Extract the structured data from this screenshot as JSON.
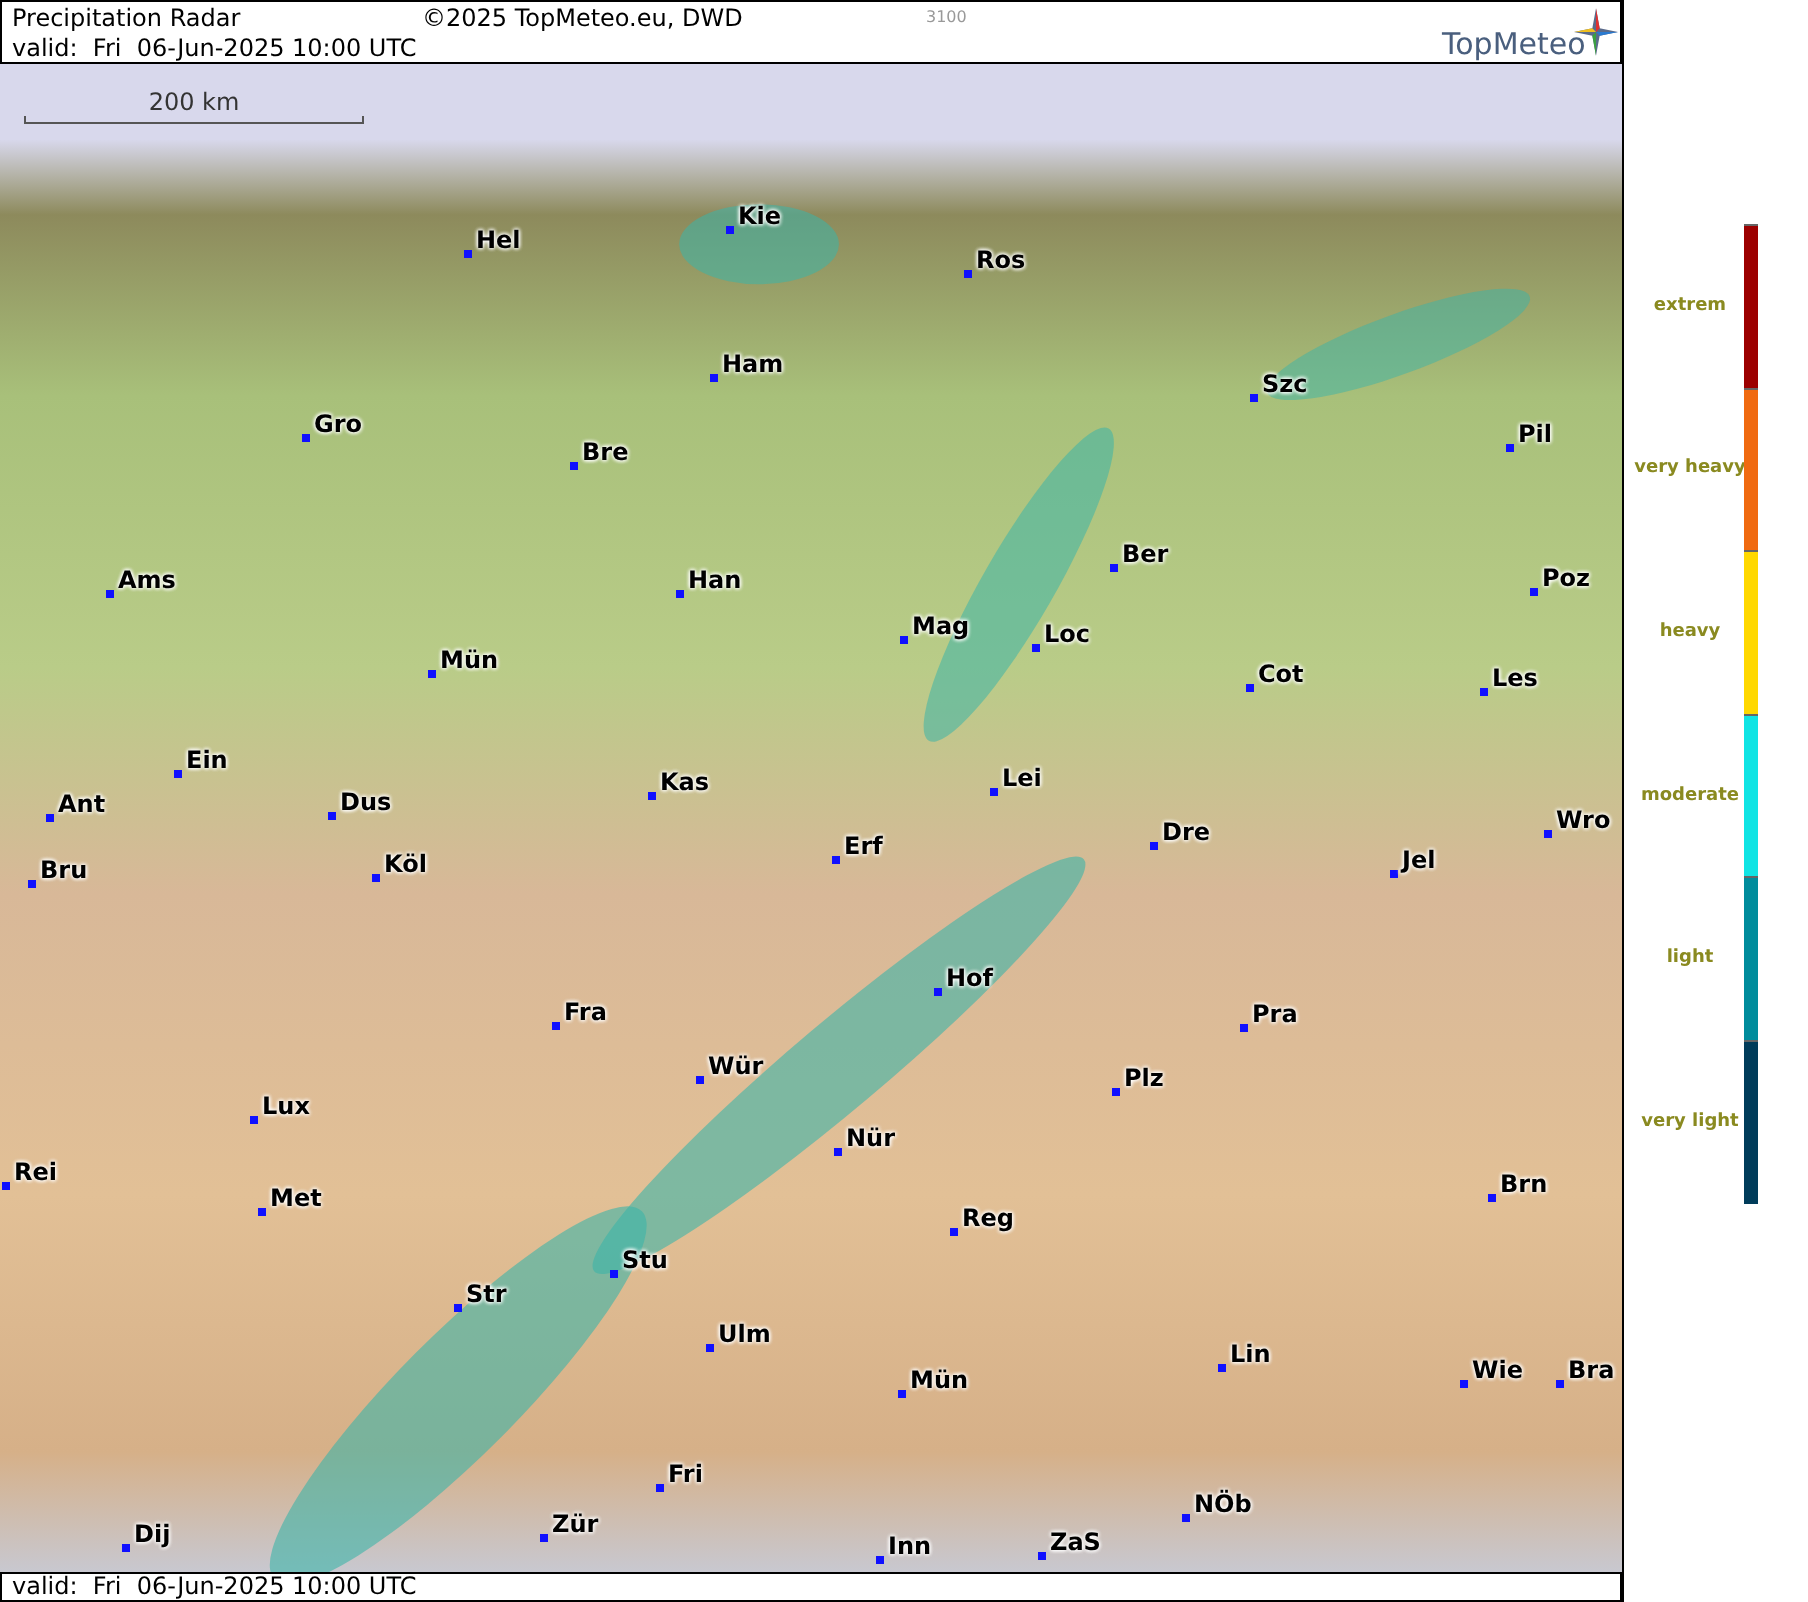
{
  "header": {
    "title": "Precipitation Radar",
    "copyright": "©2025 TopMeteo.eu, DWD",
    "code": "3100",
    "valid": "valid:  Fri  06-Jun-2025 10:00 UTC",
    "logo": "TopMeteo"
  },
  "map": {
    "scale_label": "200 km",
    "cities": [
      {
        "label": "Hel"
      },
      {
        "label": "Kie"
      },
      {
        "label": "Ros"
      },
      {
        "label": "Ham"
      },
      {
        "label": "Szc"
      },
      {
        "label": "Gro"
      },
      {
        "label": "Bre"
      },
      {
        "label": "Pil"
      },
      {
        "label": "Ber"
      },
      {
        "label": "Ams"
      },
      {
        "label": "Han"
      },
      {
        "label": "Poz"
      },
      {
        "label": "Mag"
      },
      {
        "label": "Loc"
      },
      {
        "label": "Mün"
      },
      {
        "label": "Cot"
      },
      {
        "label": "Les"
      },
      {
        "label": "Ein"
      },
      {
        "label": "Kas"
      },
      {
        "label": "Lei"
      },
      {
        "label": "Ant"
      },
      {
        "label": "Dus"
      },
      {
        "label": "Wro"
      },
      {
        "label": "Erf"
      },
      {
        "label": "Dre"
      },
      {
        "label": "Bru"
      },
      {
        "label": "Köl"
      },
      {
        "label": "Jel"
      },
      {
        "label": "Hof"
      },
      {
        "label": "Fra"
      },
      {
        "label": "Pra"
      },
      {
        "label": "Wür"
      },
      {
        "label": "Plz"
      },
      {
        "label": "Lux"
      },
      {
        "label": "Nür"
      },
      {
        "label": "Rei"
      },
      {
        "label": "Met"
      },
      {
        "label": "Brn"
      },
      {
        "label": "Reg"
      },
      {
        "label": "Stu"
      },
      {
        "label": "Str"
      },
      {
        "label": "Ulm"
      },
      {
        "label": "Lin"
      },
      {
        "label": "Mün"
      },
      {
        "label": "Wie"
      },
      {
        "label": "Bra"
      },
      {
        "label": "Fri"
      },
      {
        "label": "NÖb"
      },
      {
        "label": "Dij"
      },
      {
        "label": "Zür"
      },
      {
        "label": "Inn"
      },
      {
        "label": "ZaS"
      }
    ]
  },
  "footer": {
    "valid": "valid:  Fri  06-Jun-2025 10:00 UTC"
  },
  "legend": [
    {
      "label": "extrem",
      "color": "#9c0000"
    },
    {
      "label": "very heavy",
      "color": "#f06a10"
    },
    {
      "label": "heavy",
      "color": "#ffd800"
    },
    {
      "label": "moderate",
      "color": "#10e4e4"
    },
    {
      "label": "light",
      "color": "#008c9c"
    },
    {
      "label": "very light",
      "color": "#003c5a"
    }
  ]
}
